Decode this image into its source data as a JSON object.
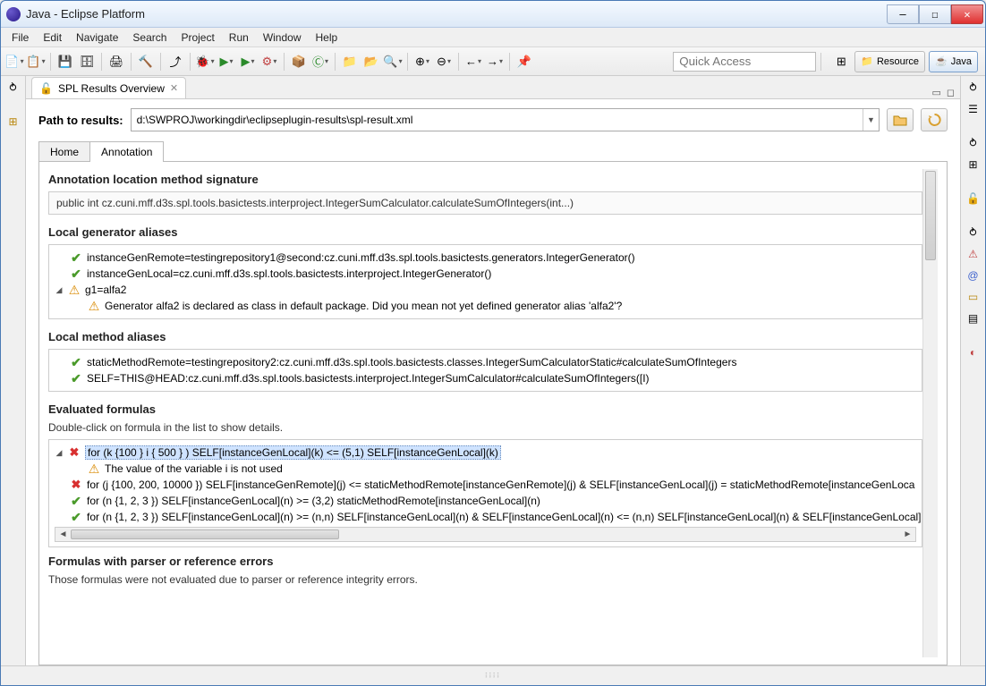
{
  "titlebar": {
    "title": "Java - Eclipse Platform"
  },
  "menu": [
    "File",
    "Edit",
    "Navigate",
    "Search",
    "Project",
    "Run",
    "Window",
    "Help"
  ],
  "quickAccess": {
    "placeholder": "Quick Access"
  },
  "perspectives": {
    "resource": "Resource",
    "java": "Java"
  },
  "view": {
    "tabTitle": "SPL Results Overview",
    "pathLabel": "Path to results:",
    "pathValue": "d:\\SWPROJ\\workingdir\\eclipseplugin-results\\spl-result.xml",
    "subtabs": {
      "home": "Home",
      "annotation": "Annotation"
    }
  },
  "anno": {
    "sigHeading": "Annotation location method signature",
    "signature": "public int cz.cuni.mff.d3s.spl.tools.basictests.interproject.IntegerSumCalculator.calculateSumOfIntegers(int...)",
    "genHeading": "Local generator aliases",
    "genItems": [
      {
        "st": "ok",
        "text": "instanceGenRemote=testingrepository1@second:cz.cuni.mff.d3s.spl.tools.basictests.generators.IntegerGenerator()"
      },
      {
        "st": "ok",
        "text": "instanceGenLocal=cz.cuni.mff.d3s.spl.tools.basictests.interproject.IntegerGenerator()"
      },
      {
        "st": "warn",
        "text": "g1=alfa2",
        "expanded": true,
        "child": {
          "st": "warn",
          "text": "Generator alfa2 is declared as class in default package. Did you mean not yet defined generator alias 'alfa2'?"
        }
      }
    ],
    "methHeading": "Local method aliases",
    "methItems": [
      {
        "st": "ok",
        "text": "staticMethodRemote=testingrepository2:cz.cuni.mff.d3s.spl.tools.basictests.classes.IntegerSumCalculatorStatic#calculateSumOfIntegers"
      },
      {
        "st": "ok",
        "text": "SELF=THIS@HEAD:cz.cuni.mff.d3s.spl.tools.basictests.interproject.IntegerSumCalculator#calculateSumOfIntegers([I)"
      }
    ],
    "formHeading": "Evaluated formulas",
    "formHint": "Double-click on formula in the list to show details.",
    "formulas": [
      {
        "st": "err",
        "text": "for (k {100 } i { 500 } ) SELF[instanceGenLocal](k) <= (5,1) SELF[instanceGenLocal](k)",
        "sel": true,
        "child": {
          "st": "warn",
          "text": "The value of the variable i is not used"
        }
      },
      {
        "st": "err",
        "text": "for (j {100, 200, 10000 }) SELF[instanceGenRemote](j) <= staticMethodRemote[instanceGenRemote](j) & SELF[instanceGenLocal](j) = staticMethodRemote[instanceGenLoca"
      },
      {
        "st": "ok",
        "text": "for (n {1, 2, 3 }) SELF[instanceGenLocal](n) >= (3,2) staticMethodRemote[instanceGenLocal](n)"
      },
      {
        "st": "ok",
        "text": "for (n {1, 2, 3 }) SELF[instanceGenLocal](n) >= (n,n) SELF[instanceGenLocal](n) & SELF[instanceGenLocal](n) <= (n,n) SELF[instanceGenLocal](n) & SELF[instanceGenLocal]"
      }
    ],
    "errHeading": "Formulas with parser or reference errors",
    "errHint": "Those formulas were not evaluated due to parser or reference integrity errors."
  }
}
